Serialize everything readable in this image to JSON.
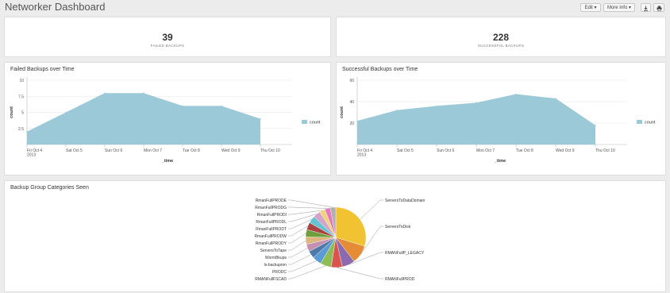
{
  "header": {
    "title": "Networker Dashboard",
    "edit_label": "Edit",
    "moreinfo_label": "More Info",
    "download_icon": "download-icon",
    "print_icon": "print-icon"
  },
  "single_values": [
    {
      "value": "39",
      "label": "FAILED BACKUPS"
    },
    {
      "value": "228",
      "label": "SUCCESSFUL BACKUPS"
    }
  ],
  "colors": {
    "area": "#9cc9d7",
    "grid": "#e6e6e6",
    "background": "#ececec"
  },
  "chart_data": [
    {
      "type": "area",
      "title": "Failed Backups over Time",
      "xlabel": "_time",
      "ylabel": "count",
      "x": [
        "Fri Oct 4\n2013",
        "Sat Oct 5",
        "Sun Oct 6",
        "Mon Oct 7",
        "Tue Oct 8",
        "Wed Oct 9",
        "Thu Oct 10"
      ],
      "ylim": [
        0,
        10
      ],
      "yticks": [
        "2.5",
        "5",
        "7.5",
        "10"
      ],
      "grid": true,
      "legend": "right",
      "series": [
        {
          "name": "count",
          "values": [
            2,
            5,
            8,
            8,
            6,
            6,
            4
          ]
        }
      ]
    },
    {
      "type": "area",
      "title": "Successful Backups over Time",
      "xlabel": "_time",
      "ylabel": "count",
      "x": [
        "Fri Oct 4\n2013",
        "Sat Oct 5",
        "Sun Oct 6",
        "Mon Oct 7",
        "Tue Oct 8",
        "Wed Oct 9",
        "Thu Oct 10"
      ],
      "ylim": [
        0,
        60
      ],
      "yticks": [
        "20",
        "40",
        "60"
      ],
      "grid": true,
      "legend": "right",
      "series": [
        {
          "name": "count",
          "values": [
            22,
            32,
            36,
            39,
            47,
            43,
            18
          ]
        }
      ]
    },
    {
      "type": "pie",
      "title": "Backup Group Categories Seen",
      "categories": [
        "ServersToDataDomain",
        "ServersToDisk",
        "RMANFullP_LEGACY",
        "RMANFullPROD",
        "RMANFullFSCAD",
        "PRODC",
        "ls-backupmn",
        "WormBkups",
        "ServersToTape",
        "RmanFullPRODY",
        "RmanFullPRODW",
        "RmanFullPRODT",
        "RmanFullPRODL",
        "RmanFullPRODI",
        "RmanFullPRODG",
        "RmanFullPRODE"
      ],
      "values": [
        30,
        10,
        7,
        6,
        6,
        5,
        4,
        4,
        4,
        4,
        4,
        4,
        4,
        3,
        3,
        3
      ],
      "colors": [
        "#f1c232",
        "#e58c36",
        "#8c6ab0",
        "#d9534f",
        "#8fbc55",
        "#5b9bd5",
        "#4e79a7",
        "#c58fb1",
        "#ddb57d",
        "#6e9f3a",
        "#a94442",
        "#66c2d2",
        "#d4a3c7",
        "#f0d27a",
        "#e377c2",
        "#b0b0b0"
      ],
      "legend": "labels"
    }
  ]
}
